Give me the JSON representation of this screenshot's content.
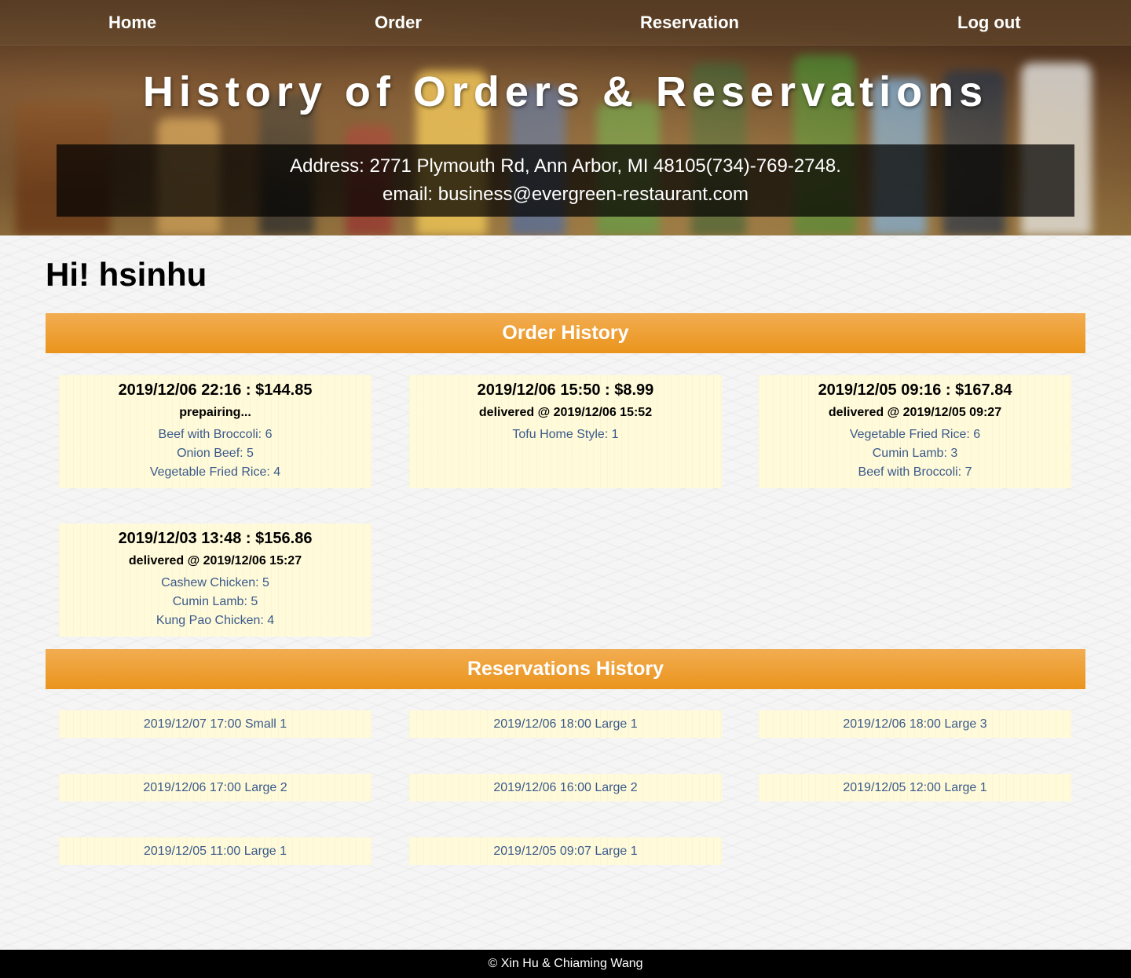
{
  "nav": {
    "home": "Home",
    "order": "Order",
    "reservation": "Reservation",
    "logout": "Log out"
  },
  "hero": {
    "title": "History of Orders & Reservations",
    "address": "Address: 2771 Plymouth Rd, Ann Arbor, MI 48105(734)-769-2748.",
    "email": "email: business@evergreen-restaurant.com"
  },
  "greeting": "Hi! hsinhu",
  "orders": {
    "title": "Order History",
    "cards": [
      {
        "head": "2019/12/06 22:16 : $144.85",
        "status": "prepairing...",
        "items": [
          "Beef with Broccoli: 6",
          "Onion Beef: 5",
          "Vegetable Fried Rice: 4"
        ]
      },
      {
        "head": "2019/12/06 15:50 : $8.99",
        "status": "delivered @ 2019/12/06 15:52",
        "items": [
          "Tofu Home Style: 1"
        ]
      },
      {
        "head": "2019/12/05 09:16 : $167.84",
        "status": "delivered @ 2019/12/05 09:27",
        "items": [
          "Vegetable Fried Rice: 6",
          "Cumin Lamb: 3",
          "Beef with Broccoli: 7"
        ]
      },
      {
        "head": "2019/12/03 13:48 : $156.86",
        "status": "delivered @ 2019/12/06 15:27",
        "items": [
          "Cashew Chicken: 5",
          "Cumin Lamb: 5",
          "Kung Pao Chicken: 4"
        ]
      }
    ]
  },
  "reservations": {
    "title": "Reservations History",
    "items": [
      "2019/12/07 17:00 Small 1",
      "2019/12/06 18:00 Large 1",
      "2019/12/06 18:00 Large 3",
      "2019/12/06 17:00 Large 2",
      "2019/12/06 16:00 Large 2",
      "2019/12/05 12:00 Large 1",
      "2019/12/05 11:00 Large 1",
      "2019/12/05 09:07 Large 1"
    ]
  },
  "footer": "© Xin Hu & Chiaming Wang",
  "colors": {
    "accent_orange": "#ea941c",
    "card_bg": "#fffad9",
    "item_link": "#3a5a8c",
    "footer_bg": "#000000"
  }
}
